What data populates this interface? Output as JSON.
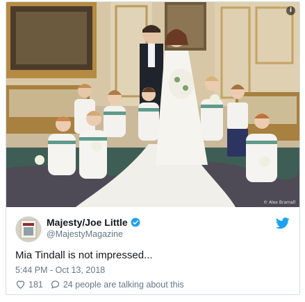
{
  "photo": {
    "credit": "© Alex Bramall",
    "info_glyph": "i",
    "image_icon": "wedding-group-photo"
  },
  "tweet": {
    "display_name": "Majesty/Joe Little",
    "handle": "@MajestyMagazine",
    "verified_icon": "verified-badge-icon",
    "brand_icon": "twitter-bird-icon",
    "text": "Mia Tindall is not impressed...",
    "timestamp": "5:44 PM - Oct 13, 2018",
    "likes": "181",
    "conversation": "24 people are talking about this"
  },
  "colors": {
    "twitter_blue": "#1da1f2",
    "text_primary": "#14171a",
    "text_secondary": "#657786",
    "border": "#d6dde2"
  }
}
